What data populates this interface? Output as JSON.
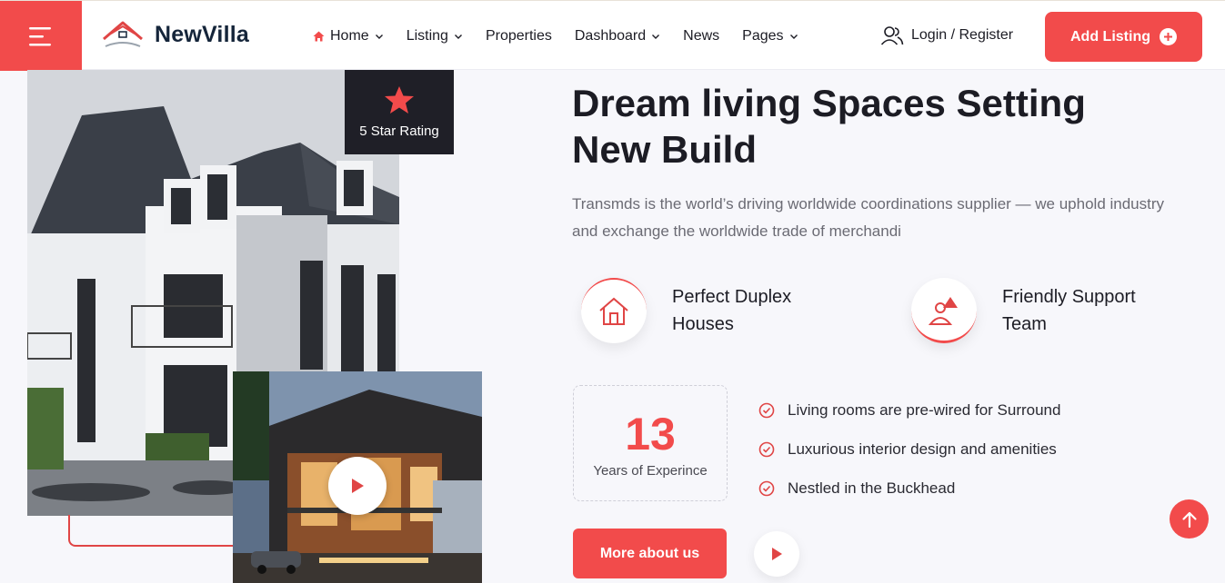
{
  "header": {
    "logo_text": "NewVilla",
    "nav": [
      {
        "label": "Home",
        "has_dropdown": true,
        "active": true
      },
      {
        "label": "Listing",
        "has_dropdown": true
      },
      {
        "label": "Properties",
        "has_dropdown": false
      },
      {
        "label": "Dashboard",
        "has_dropdown": true
      },
      {
        "label": "News",
        "has_dropdown": false
      },
      {
        "label": "Pages",
        "has_dropdown": true
      }
    ],
    "login_label": "Login / Register",
    "add_listing_label": "Add Listing"
  },
  "hero": {
    "rating_label": "5 Star Rating",
    "headline": "Dream living Spaces Setting New Build",
    "description": "Transmds is the world’s driving worldwide coordinations supplier — we uphold industry and exchange the worldwide trade of merchandi",
    "features": [
      {
        "label": "Perfect Duplex Houses",
        "icon": "house-icon"
      },
      {
        "label": "Friendly Support Team",
        "icon": "support-icon"
      }
    ],
    "years_number": "13",
    "years_label": "Years of Experince",
    "checklist": [
      "Living rooms are pre-wired for Surround",
      "Luxurious interior design and amenities",
      "Nestled in the Buckhead"
    ],
    "more_button": "More about us"
  },
  "colors": {
    "accent": "#f24b4b",
    "dark": "#1f1f27",
    "text": "#1c1c24",
    "muted": "#6b6b74"
  }
}
